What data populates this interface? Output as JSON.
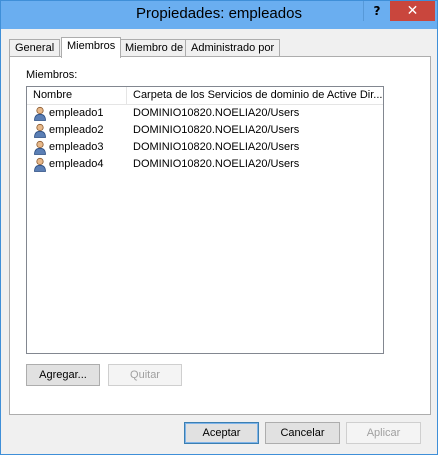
{
  "window": {
    "title": "Propiedades: empleados",
    "help_glyph": "?",
    "close_glyph": "✕"
  },
  "tabs": [
    {
      "label": "General",
      "active": false
    },
    {
      "label": "Miembros",
      "active": true
    },
    {
      "label": "Miembro de",
      "active": false
    },
    {
      "label": "Administrado por",
      "active": false
    }
  ],
  "members": {
    "label": "Miembros:",
    "columns": [
      "Nombre",
      "Carpeta de los Servicios de dominio de Active Dir..."
    ],
    "rows": [
      {
        "name": "empleado1",
        "folder": "DOMINIO10820.NOELIA20/Users",
        "icon": "user-icon"
      },
      {
        "name": "empleado2",
        "folder": "DOMINIO10820.NOELIA20/Users",
        "icon": "user-icon"
      },
      {
        "name": "empleado3",
        "folder": "DOMINIO10820.NOELIA20/Users",
        "icon": "user-icon"
      },
      {
        "name": "empleado4",
        "folder": "DOMINIO10820.NOELIA20/Users",
        "icon": "user-icon"
      }
    ],
    "add_label": "Agregar...",
    "remove_label": "Quitar"
  },
  "footer": {
    "ok_label": "Aceptar",
    "cancel_label": "Cancelar",
    "apply_label": "Aplicar"
  }
}
